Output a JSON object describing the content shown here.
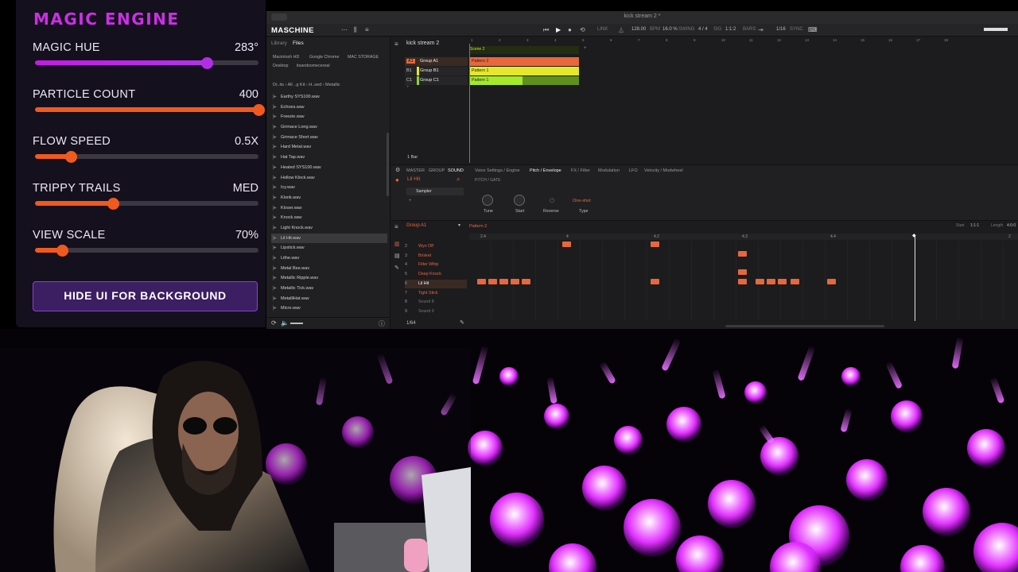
{
  "magic_panel": {
    "title": "MAGIC ENGINE",
    "controls": [
      {
        "label": "MAGIC HUE",
        "value": "283°",
        "level": 0.77,
        "fill": "linear-gradient(90deg,#c61ae6,#b035e6)",
        "knob": "#b22ee6"
      },
      {
        "label": "PARTICLE COUNT",
        "value": "400",
        "level": 1.0,
        "fill": "#f05a1e",
        "knob": "#f05a1e"
      },
      {
        "label": "FLOW SPEED",
        "value": "0.5X",
        "level": 0.16,
        "fill": "#f05a1e",
        "knob": "#f05a1e"
      },
      {
        "label": "TRIPPY TRAILS",
        "value": "MED",
        "level": 0.35,
        "fill": "#f05a1e",
        "knob": "#f05a1e"
      },
      {
        "label": "VIEW SCALE",
        "value": "70%",
        "level": 0.12,
        "fill": "#f05a1e",
        "knob": "#f05a1e"
      }
    ],
    "hide_button": "HIDE UI FOR BACKGROUND"
  },
  "maschine": {
    "window_title": "kick stream 2 *",
    "logo": "MASCHINE",
    "transport": {
      "link": "LINK",
      "bpm": "128.00",
      "bpm_unit": "BPM",
      "swing": "16.0 %",
      "swing_label": "SWING",
      "signature": "4 / 4",
      "signature_label": "SIG",
      "position": "1:1:2",
      "bars_label": "BARS",
      "grid": "1/16",
      "sync": "SYNC"
    },
    "browser": {
      "tabs": [
        "Library",
        "Files"
      ],
      "sources": [
        "Macintosh HD",
        "Google Chrome",
        "MAC STORAGE",
        "Desktop",
        "itsandsomecereal"
      ],
      "path": "Dr..its  ›  All ..g Kit  ›  H..sed  ›  Metallic",
      "files": [
        "Earthy SYS100.wav",
        "Echoes.wav",
        "Freezie.wav",
        "Grimace Long.wav",
        "Grimace Short.wav",
        "Hard Metal.wav",
        "Hat Tap.wav",
        "Heated SYS100.wav",
        "Hollow Klock.wav",
        "Icy.wav",
        "Klonk.wav",
        "Kloser.wav",
        "Knock.wav",
        "Light Knock.wav",
        "Lil Hit.wav",
        "Lipstick.wav",
        "Lithe.wav",
        "Metal Bee.wav",
        "Metallic Ripple.wav",
        "Metallic Tick.wav",
        "MetalliHat.wav",
        "Micro.wav"
      ],
      "selected_file": "Lil Hit.wav"
    },
    "arranger": {
      "project": "kick stream 2",
      "scene": "Scene 2",
      "bar_length": "1 Bar",
      "groups": [
        {
          "id": "A1",
          "name": "Group A1",
          "color": "#e8673c",
          "pattern": "Pattern 2"
        },
        {
          "id": "B1",
          "name": "Group B1",
          "color": "#e6e62a",
          "pattern": "Pattern 1"
        },
        {
          "id": "C1",
          "name": "Group C1",
          "color": "#8ed42a",
          "pattern": "Pattern 1"
        }
      ],
      "ruler": [
        "1",
        "2",
        "3",
        "4",
        "5",
        "6",
        "7",
        "8",
        "9",
        "10",
        "11",
        "12",
        "13",
        "14",
        "15",
        "16",
        "17",
        "18"
      ]
    },
    "sound": {
      "tabs_left": [
        "MASTER",
        "GROUP",
        "SOUND"
      ],
      "sound_name": "Lil Hit",
      "plugin": "Sampler",
      "tabs_right": [
        "Voice Settings / Engine",
        "Pitch / Envelope",
        "FX / Filter",
        "Modulation",
        "LFO",
        "Velocity / Modwheel"
      ],
      "section": "PITCH / GATE",
      "knobs": [
        "Tune",
        "Start",
        "Reverse",
        "Type"
      ],
      "type_value": "One-shot"
    },
    "pattern": {
      "group": "Group A1",
      "pattern_name": "Pattern 2",
      "start_label": "Start",
      "start_value": "1:1:1",
      "length_label": "Length",
      "length_value": "4:0:0",
      "ticks": [
        "2.4",
        "4",
        "4.2",
        "4.3",
        "4.4",
        "2"
      ],
      "zoom": "1/64",
      "sounds": [
        {
          "num": "2",
          "name": "Wyo Off",
          "color": "#e8673c"
        },
        {
          "num": "3",
          "name": "Brisket",
          "color": "#e8673c"
        },
        {
          "num": "4",
          "name": "Filter Whip",
          "color": "#e8673c"
        },
        {
          "num": "5",
          "name": "Deep Knock",
          "color": "#e8673c"
        },
        {
          "num": "6",
          "name": "Lil Hit",
          "color": "#ffffff"
        },
        {
          "num": "7",
          "name": "Tight Stick",
          "color": "#e8673c"
        },
        {
          "num": "8",
          "name": "Sound 8",
          "color": "#777777"
        },
        {
          "num": "9",
          "name": "Sound 9",
          "color": "#777777"
        }
      ]
    }
  },
  "scene": {
    "orb_color": "#e030ff",
    "background": "#050208"
  }
}
